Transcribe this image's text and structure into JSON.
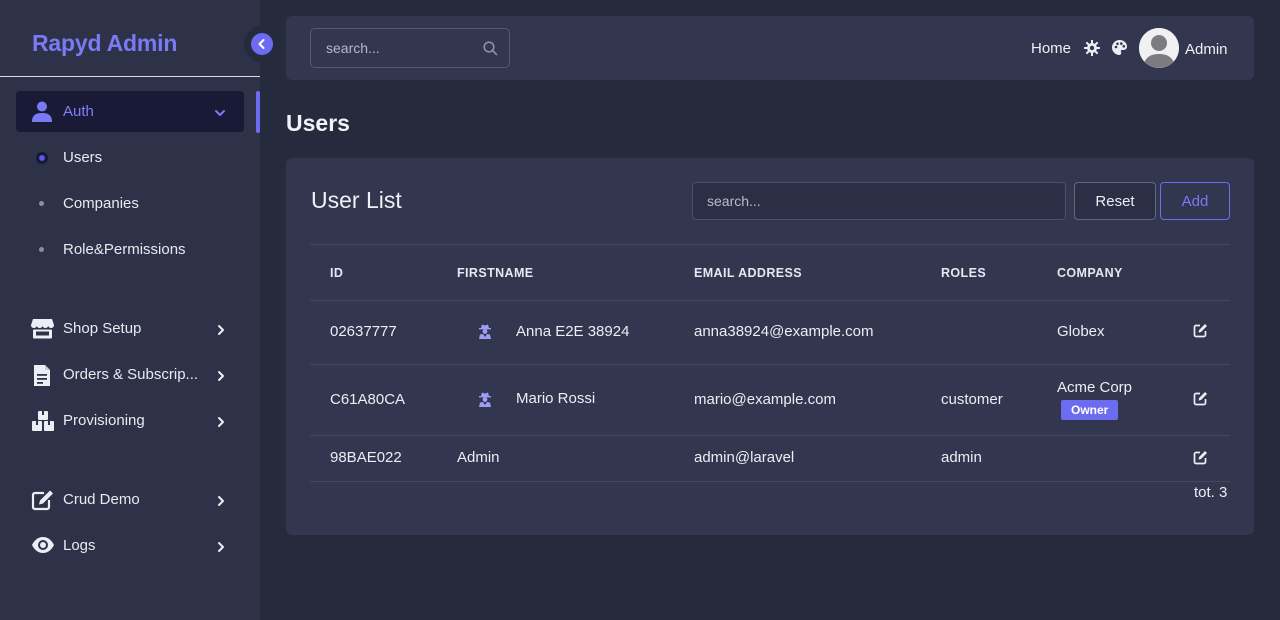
{
  "app": {
    "brand": "Rapyd Admin"
  },
  "colors": {
    "accent": "#6c6cf0",
    "sidebar_bg": "#2e3248",
    "page_bg": "#262a3d",
    "card_bg": "#32364f"
  },
  "sidebar": {
    "auth": {
      "label": "Auth",
      "icon": "user-icon"
    },
    "auth_items": [
      {
        "label": "Users",
        "active": true
      },
      {
        "label": "Companies"
      },
      {
        "label": "Role&Permissions"
      }
    ],
    "items": [
      {
        "label": "Shop Setup",
        "icon": "store-icon"
      },
      {
        "label": "Orders & Subscrip...",
        "icon": "document-icon"
      },
      {
        "label": "Provisioning",
        "icon": "boxes-icon"
      },
      {
        "label": "Crud Demo",
        "icon": "edit-icon"
      },
      {
        "label": "Logs",
        "icon": "eye-icon"
      }
    ]
  },
  "topbar": {
    "search_placeholder": "search...",
    "home_label": "Home",
    "user_name": "Admin"
  },
  "page": {
    "title": "Users"
  },
  "user_list": {
    "title": "User List",
    "search_placeholder": "search...",
    "reset_label": "Reset",
    "add_label": "Add",
    "columns": [
      "ID",
      "FIRSTNAME",
      "EMAIL ADDRESS",
      "ROLES",
      "COMPANY"
    ],
    "rows": [
      {
        "id": "02637777",
        "firstname": "Anna E2E 38924",
        "email": "anna38924@example.com",
        "roles": "",
        "company": "Globex",
        "badge": ""
      },
      {
        "id": "C61A80CA",
        "firstname": "Mario Rossi",
        "email": "mario@example.com",
        "roles": "customer",
        "company": "Acme Corp",
        "badge": "Owner"
      },
      {
        "id": "98BAE022",
        "firstname": "Admin",
        "email": "admin@laravel",
        "roles": "admin",
        "company": "",
        "badge": ""
      }
    ],
    "total": "tot. 3"
  }
}
